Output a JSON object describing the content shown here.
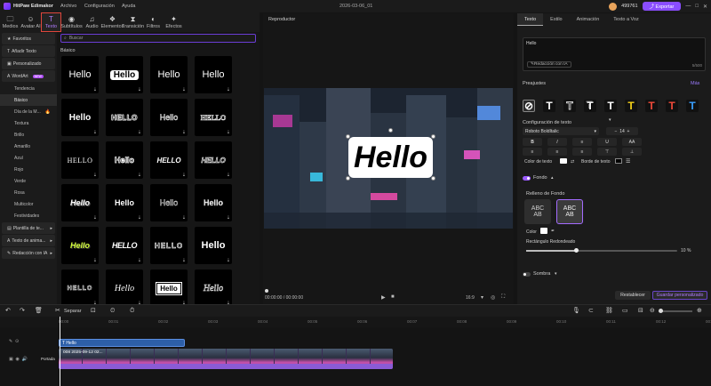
{
  "titlebar": {
    "app_name": "HitPaw Edimakor",
    "menu": [
      "Archivo",
      "Configuración",
      "Ayuda"
    ],
    "date": "2026-03-06_01",
    "credits": "499761",
    "export_label": "Exportar",
    "window_controls": [
      "—",
      "□",
      "✕"
    ]
  },
  "top_tabs": [
    {
      "label": "Medios",
      "icon": "folder-icon",
      "glyph": "🗀"
    },
    {
      "label": "Avatar AI",
      "icon": "avatar-icon",
      "glyph": "☺"
    },
    {
      "label": "Texto",
      "icon": "text-icon",
      "glyph": "T"
    },
    {
      "label": "Subtítulos",
      "icon": "subtitle-icon",
      "glyph": "◉"
    },
    {
      "label": "Audio",
      "icon": "audio-icon",
      "glyph": "♫"
    },
    {
      "label": "Elementos",
      "icon": "elements-icon",
      "glyph": "❖"
    },
    {
      "label": "Transición",
      "icon": "transition-icon",
      "glyph": "⧗"
    },
    {
      "label": "Filtros",
      "icon": "filter-icon",
      "glyph": "◐"
    },
    {
      "label": "Efectos",
      "icon": "effects-icon",
      "glyph": "✦"
    }
  ],
  "sidebar": {
    "items": [
      {
        "label": "Favoritos",
        "icon": "star-icon",
        "glyph": "★",
        "kind": "group"
      },
      {
        "label": "Añadir Texto",
        "icon": "add-text-icon",
        "glyph": "T",
        "kind": "group"
      },
      {
        "label": "Personalizado",
        "icon": "custom-icon",
        "glyph": "▣",
        "kind": "group"
      },
      {
        "label": "WordArt",
        "icon": "wordart-icon",
        "glyph": "A",
        "kind": "group",
        "badge": "NEW"
      },
      {
        "label": "Tendencia",
        "kind": "sub"
      },
      {
        "label": "Básico",
        "kind": "sub",
        "selected": true
      },
      {
        "label": "Día de la M...",
        "kind": "sub",
        "flame": true
      },
      {
        "label": "Textura",
        "kind": "sub"
      },
      {
        "label": "Brillo",
        "kind": "sub"
      },
      {
        "label": "Amarillo",
        "kind": "sub"
      },
      {
        "label": "Azul",
        "kind": "sub"
      },
      {
        "label": "Rojo",
        "kind": "sub"
      },
      {
        "label": "Verde",
        "kind": "sub"
      },
      {
        "label": "Rosa",
        "kind": "sub"
      },
      {
        "label": "Multicolor",
        "kind": "sub"
      },
      {
        "label": "Festividades",
        "kind": "sub"
      },
      {
        "label": "Plantilla de te...",
        "icon": "template-icon",
        "glyph": "▤",
        "kind": "group"
      },
      {
        "label": "Texto de anima...",
        "icon": "animation-icon",
        "glyph": "A",
        "kind": "group"
      },
      {
        "label": "Redacción con IA",
        "icon": "ai-icon",
        "glyph": "✎",
        "kind": "group"
      }
    ]
  },
  "grid": {
    "search_placeholder": "Buscar",
    "section_title": "Básico",
    "tiles": [
      "Hello",
      "Hello",
      "Hello",
      "Hello",
      "Hello",
      "HELLO",
      "Hello",
      "HELLO",
      "HELLO",
      "Hello",
      "HELLO",
      "HELLO",
      "Hello",
      "Hello",
      "Hello",
      "Hello",
      "Hello",
      "HELLO",
      "HELLO",
      "Hello",
      "HELLO",
      "Hello",
      "Hello",
      "Hello"
    ]
  },
  "player": {
    "header": "Reproductor",
    "canvas_text": "Hello",
    "time": "00:00:00 / 00:00:00",
    "aspect": "16:9"
  },
  "right_panel": {
    "tabs": [
      "Texto",
      "Estilo",
      "Animación",
      "Texto a Voz"
    ],
    "text_value": "Hello",
    "ai_write_label": "Redacción con IA",
    "char_count": "5/500",
    "presets_label": "Preajustes",
    "more_label": "Más",
    "presets": [
      {
        "glyph": "⊘",
        "color": "#ffffff",
        "bg": "#2a2a2a"
      },
      {
        "glyph": "T",
        "color": "#ffffff",
        "bg": "#111111"
      },
      {
        "glyph": "T",
        "color": "#000000",
        "bg": "#111111"
      },
      {
        "glyph": "T",
        "color": "#ffffff",
        "bg": "#111111"
      },
      {
        "glyph": "T",
        "color": "#ffffff",
        "bg": "#111111"
      },
      {
        "glyph": "T",
        "color": "#f5d21a",
        "bg": "#111111"
      },
      {
        "glyph": "T",
        "color": "#f04a3a",
        "bg": "#111111"
      },
      {
        "glyph": "T",
        "color": "#f04a3a",
        "bg": "#111111"
      },
      {
        "glyph": "T",
        "color": "#3aa0ff",
        "bg": "#111111"
      }
    ],
    "text_config_label": "Configuración de texto",
    "font_name": "Roboto BoldItalic",
    "font_size": "14",
    "text_color_label": "Color de texto",
    "border_label": "Borde de texto",
    "fill_label": "Fondo",
    "fill_section_label": "Relleno de Fondo",
    "fill_card_text": "ABC\nAB",
    "color_label": "Color",
    "rounded_label": "Rectángulo Redondeado",
    "rounded_value": "10 %",
    "rounded_fraction": 0.33,
    "shadow_label": "Sombra",
    "reset_label": "Restablecer",
    "save_custom_label": "Guardar personalizado"
  },
  "toolbar": {
    "split_label": "Separar"
  },
  "ruler": [
    "00:00",
    "00:01",
    "00:02",
    "00:03",
    "00:04",
    "00:05",
    "00:06",
    "00:07",
    "00:08",
    "00:09",
    "00:10",
    "00:11",
    "00:12",
    "00:13"
  ],
  "timeline": {
    "text_clip_label": "Hello",
    "video_clip_label": "008 2025-09-12 02...",
    "track_label": "Portada"
  },
  "colors": {
    "accent": "#8a4dff",
    "highlight_border": "#e0463c"
  }
}
